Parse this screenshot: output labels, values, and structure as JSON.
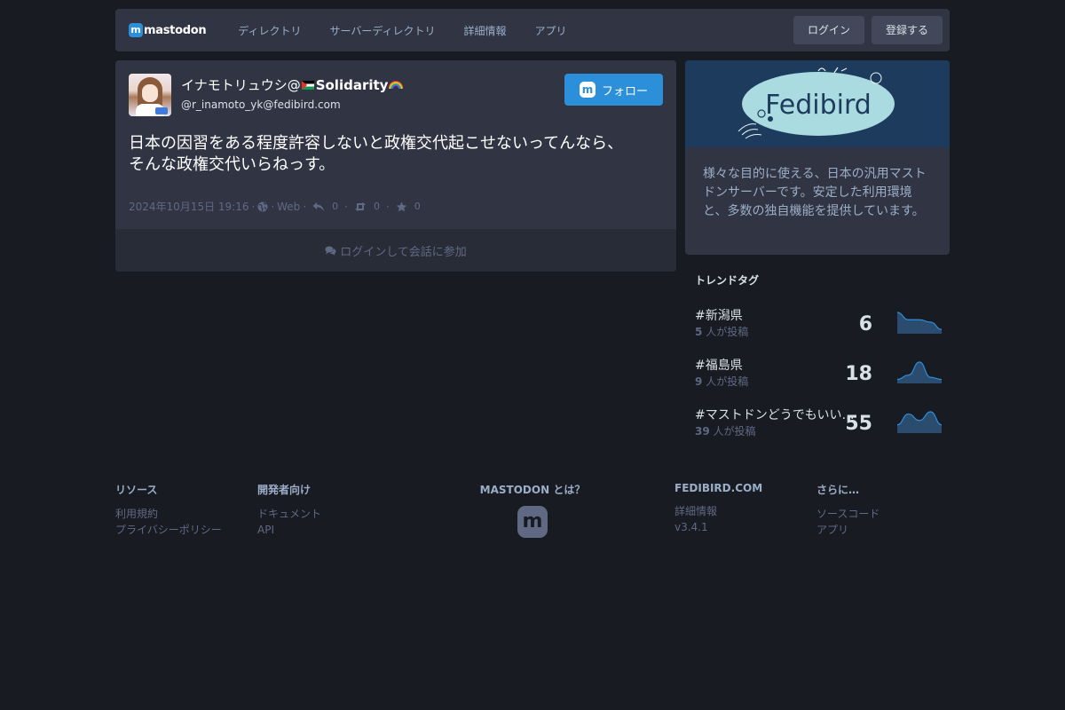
{
  "header": {
    "logo_text": "mastodon",
    "nav": [
      "ディレクトリ",
      "サーバーディレクトリ",
      "詳細情報",
      "アプリ"
    ],
    "login_label": "ログイン",
    "signup_label": "登録する"
  },
  "status": {
    "display_name_prefix": "イナモトリュウシ@",
    "display_name_bold": "Solidarity",
    "acct": "@r_inamoto_yk@fedibird.com",
    "follow_label": "フォロー",
    "content_line1": "日本の因習をある程度許容しないと政権交代起こせないってんなら、",
    "content_line2": "そんな政権交代いらねっす。",
    "timestamp": "2024年10月15日 19:16",
    "visibility_sep": "·",
    "application": "Web",
    "reply_count": "0",
    "boost_count": "0",
    "fav_count": "0",
    "login_prompt": "ログインして会話に参加"
  },
  "server": {
    "banner_text": "Fedibird",
    "description": "様々な目的に使える、日本の汎用マストドンサーバーです。安定した利用環境と、多数の独自機能を提供しています。"
  },
  "trends": {
    "title": "トレンドタグ",
    "items": [
      {
        "tag": "#新潟県",
        "people": "5",
        "suffix": "人が投稿",
        "uses": "6",
        "history": [
          8,
          5,
          5,
          4,
          1
        ]
      },
      {
        "tag": "#福島県",
        "people": "9",
        "suffix": "人が投稿",
        "uses": "18",
        "history": [
          1,
          3,
          9,
          2,
          1
        ]
      },
      {
        "tag": "#マストドンどうでもいい…",
        "people": "39",
        "suffix": "人が投稿",
        "uses": "55",
        "history": [
          3,
          8,
          5,
          9,
          3
        ]
      }
    ]
  },
  "footer": {
    "resources": {
      "title": "リソース",
      "links": [
        "利用規約",
        "プライバシーポリシー"
      ]
    },
    "developers": {
      "title": "開発者向け",
      "links": [
        "ドキュメント",
        "API"
      ]
    },
    "about_mastodon": {
      "title": "MASTODON とは？"
    },
    "server": {
      "title": "FEDIBIRD.COM",
      "links": [
        "詳細情報",
        "v3.4.1"
      ]
    },
    "more": {
      "title": "さらに…",
      "links": [
        "ソースコード",
        "アプリ"
      ]
    }
  },
  "colors": {
    "accent": "#2b90d9",
    "background": "#191b22",
    "card": "#313543"
  }
}
